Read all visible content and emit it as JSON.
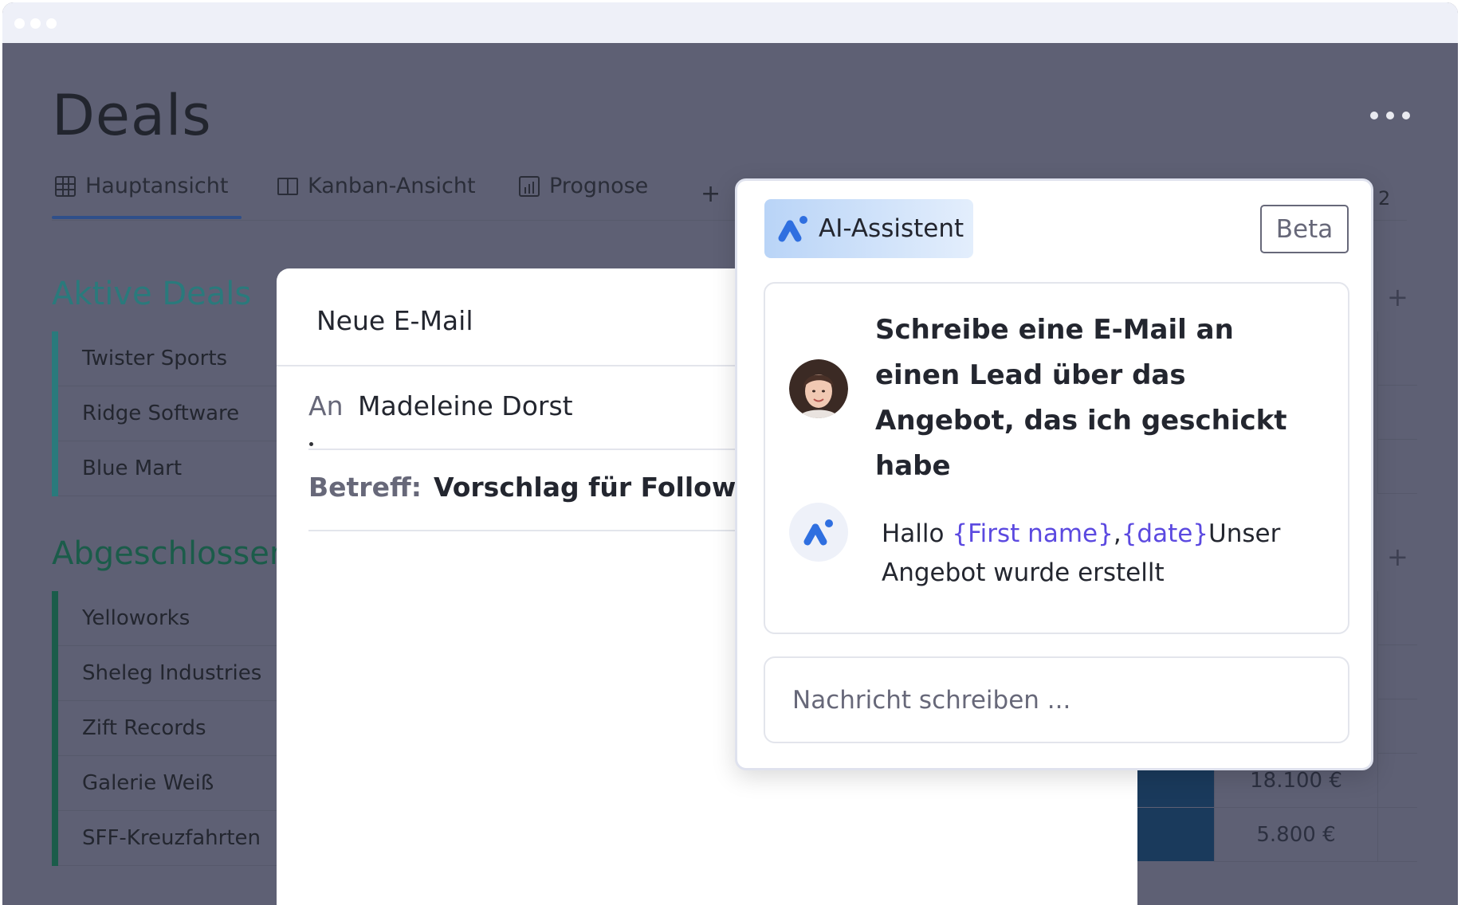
{
  "board": {
    "title": "Deals",
    "tabs": [
      {
        "label": "Hauptansicht",
        "icon": "table-icon",
        "active": true
      },
      {
        "label": "Kanban-Ansicht",
        "icon": "kanban-icon",
        "active": false
      },
      {
        "label": "Prognose",
        "icon": "chart-icon",
        "active": false
      }
    ],
    "add_tab_label": "+",
    "tab_overflow_count": "2",
    "add_column_label": "+",
    "groups": [
      {
        "title": "Aktive Deals",
        "color": "#2a7a7c",
        "items": [
          "Twister Sports",
          "Ridge Software",
          "Blue Mart"
        ]
      },
      {
        "title": "Abgeschlossen",
        "color": "#1b5c4a",
        "items": [
          "Yelloworks",
          "Sheleg Industries",
          "Zift Records",
          "Galerie Weiß",
          "SFF-Kreuzfahrten"
        ]
      }
    ],
    "amounts": [
      "18.100 €",
      "5.800 €"
    ]
  },
  "email": {
    "header": "Neue E-Mail",
    "to_label": "An",
    "to_value": "Madeleine Dorst",
    "subject_label": "Betreff:",
    "subject_value": "Vorschlag für Follow-up"
  },
  "ai": {
    "badge_label": "AI-Assistent",
    "beta_label": "Beta",
    "user_message": "Schreibe eine E-Mail an einen Lead über das Angebot, das ich geschickt habe",
    "response": {
      "greeting": "Hallo ",
      "var_first_name": "{First name}",
      "comma": ",",
      "var_date": "{date}",
      "text": "Unser Angebot wurde erstellt"
    },
    "input_placeholder": "Nachricht schreiben ..."
  },
  "colors": {
    "accent_blue": "#2f4f8a",
    "variable_purple": "#5b49e0",
    "overlay_gray": "#5e6074"
  }
}
